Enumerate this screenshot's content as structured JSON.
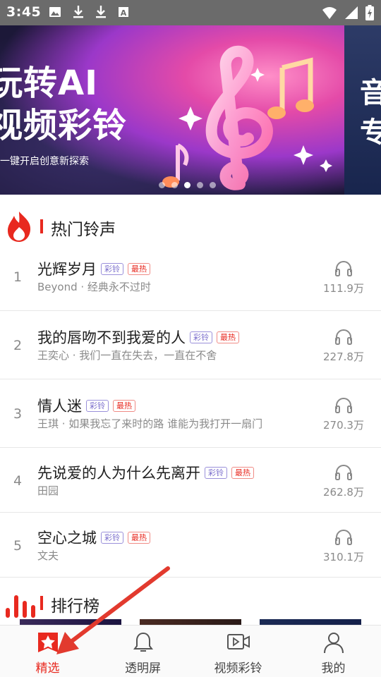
{
  "status_bar": {
    "time": "3:45"
  },
  "banner": {
    "title_line1": "玩转AI",
    "title_line2": "视频彩铃",
    "subtitle": "一键开启创意新探索",
    "next_slide_text": "音专",
    "active_dot": 3,
    "dot_count": 5
  },
  "hot_section": {
    "title": "热门铃声"
  },
  "songs": [
    {
      "rank": "1",
      "title": "光辉岁月",
      "desc": "Beyond · 经典永不过时",
      "tag1": "彩铃",
      "tag2": "最热",
      "plays": "111.9万"
    },
    {
      "rank": "2",
      "title": "我的唇吻不到我爱的人",
      "desc": "王奕心 · 我们一直在失去，一直在不舍",
      "tag1": "彩铃",
      "tag2": "最热",
      "plays": "227.8万"
    },
    {
      "rank": "3",
      "title": "情人迷",
      "desc": "王琪 · 如果我忘了来时的路 谁能为我打开一扇门",
      "tag1": "彩铃",
      "tag2": "最热",
      "plays": "270.3万"
    },
    {
      "rank": "4",
      "title": "先说爱的人为什么先离开",
      "desc": "田园",
      "tag1": "彩铃",
      "tag2": "最热",
      "plays": "262.8万"
    },
    {
      "rank": "5",
      "title": "空心之城",
      "desc": "文夫",
      "tag1": "彩铃",
      "tag2": "最热",
      "plays": "310.1万"
    }
  ],
  "chart_section": {
    "title": "排行榜"
  },
  "nav": [
    {
      "label": "精选",
      "active": true
    },
    {
      "label": "透明屏",
      "active": false
    },
    {
      "label": "视频彩铃",
      "active": false
    },
    {
      "label": "我的",
      "active": false
    }
  ],
  "colors": {
    "accent": "#e8291f",
    "tag_purple": "#7a6dcc",
    "status_bar": "#6b6b6b"
  }
}
